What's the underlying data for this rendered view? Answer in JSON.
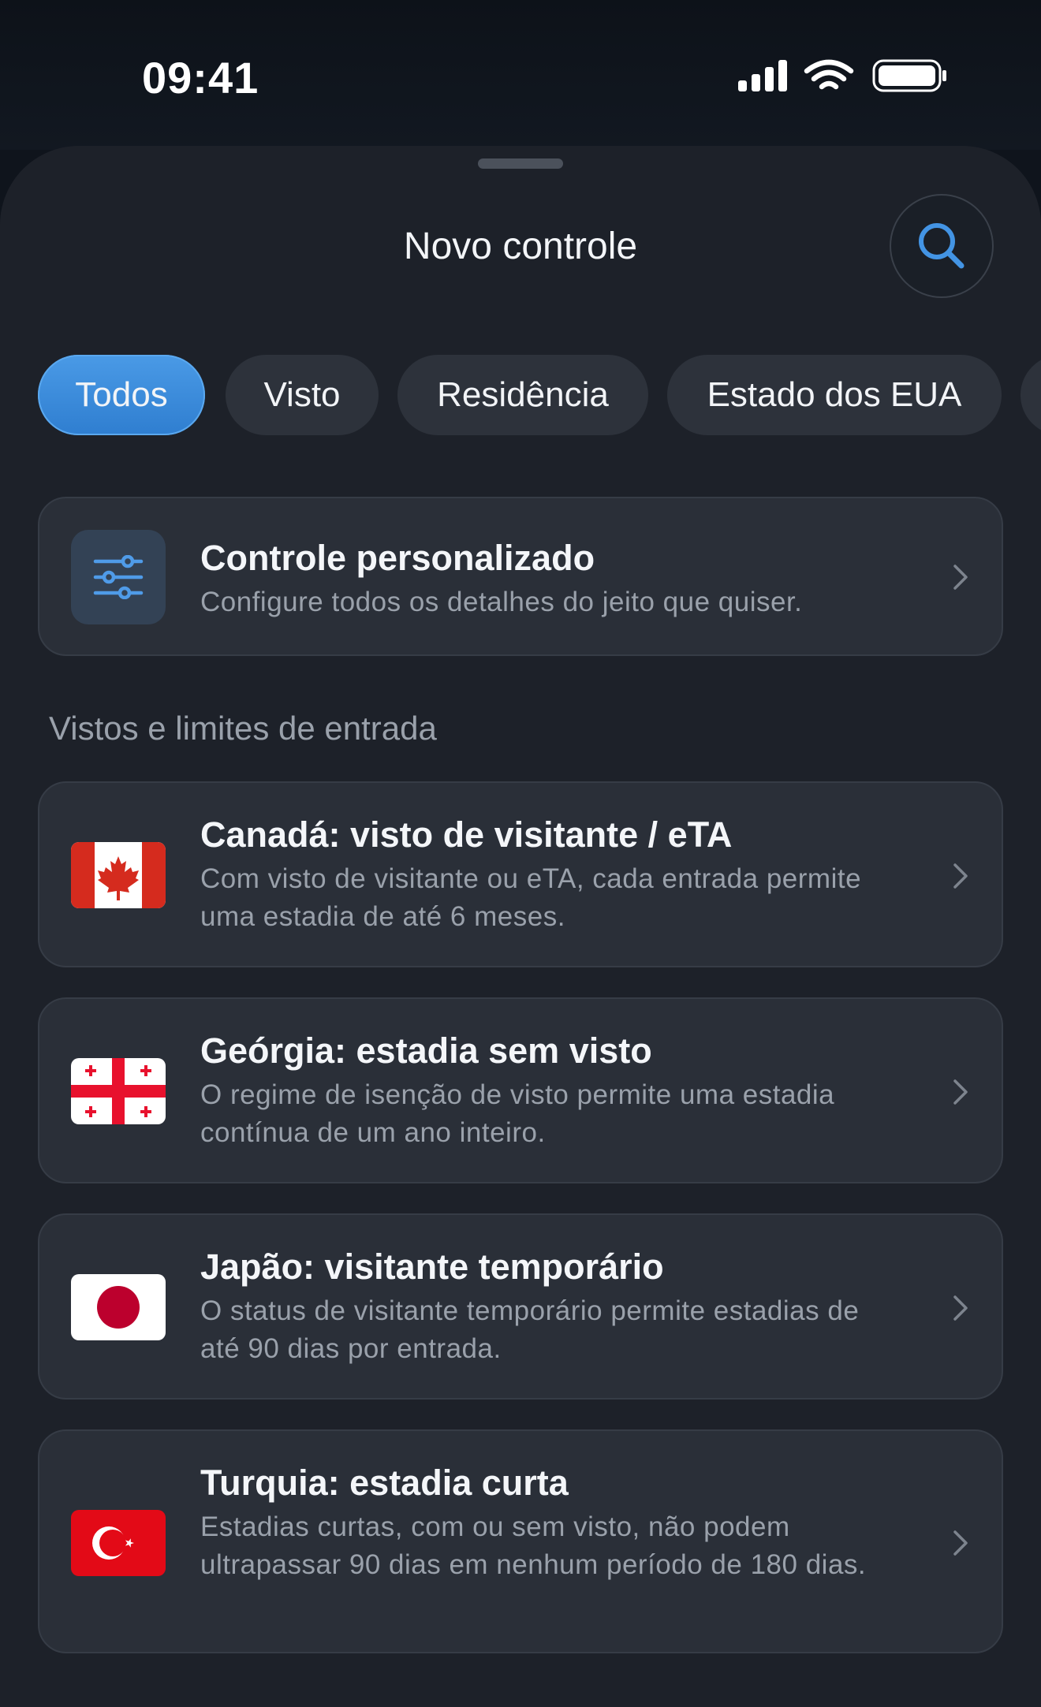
{
  "status_bar": {
    "time": "09:41"
  },
  "sheet": {
    "title": "Novo controle"
  },
  "filters": [
    {
      "label": "Todos",
      "active": true
    },
    {
      "label": "Visto",
      "active": false
    },
    {
      "label": "Residência",
      "active": false
    },
    {
      "label": "Estado dos EUA",
      "active": false
    }
  ],
  "custom_card": {
    "title": "Controle personalizado",
    "description": "Configure todos os detalhes do jeito que quiser."
  },
  "section": {
    "title": "Vistos e limites de entrada"
  },
  "items": [
    {
      "flag": "canada-flag",
      "title": "Canadá: visto de visitante / eTA",
      "description": "Com visto de visitante ou eTA, cada entrada permite uma estadia de até 6 meses."
    },
    {
      "flag": "georgia-flag",
      "title": "Geórgia: estadia sem visto",
      "description": "O regime de isenção de visto permite uma estadia contínua de um ano inteiro."
    },
    {
      "flag": "japan-flag",
      "title": "Japão: visitante temporário",
      "description": "O status de visitante temporário permite estadias de até 90 dias por entrada."
    },
    {
      "flag": "turkey-flag",
      "title": "Turquia: estadia curta",
      "description": "Estadias curtas, com ou sem visto, não podem ultrapassar 90 dias em nenhum período de 180 dias."
    }
  ],
  "colors": {
    "accent": "#3d8fe0",
    "background": "#1d2129",
    "card": "#2a2f38"
  }
}
